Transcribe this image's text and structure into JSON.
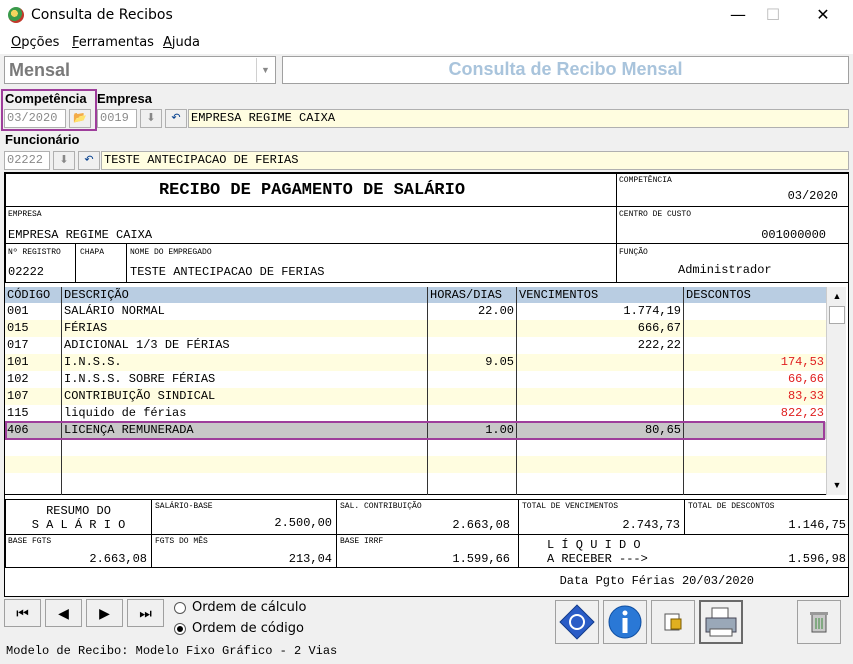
{
  "window": {
    "title": "Consulta de Recibos",
    "minimize": "—",
    "maximize": "☐",
    "close": "✕"
  },
  "menu": {
    "opcoes_ul": "O",
    "opcoes_rest": "pções",
    "ferramentas_ul": "F",
    "ferramentas_rest": "erramentas",
    "ajuda_ul": "A",
    "ajuda_rest": "juda"
  },
  "period_select": {
    "value": "Mensal"
  },
  "banner": "Consulta de Recibo Mensal",
  "filters": {
    "competencia_label": "Competência",
    "empresa_label": "Empresa",
    "funcionario_label": "Funcionário",
    "competencia_value": "03/2020",
    "empresa_code": "0019",
    "empresa_name": "EMPRESA REGIME CAIXA",
    "funcionario_code": "02222",
    "funcionario_name": "TESTE ANTECIPACAO DE FERIAS"
  },
  "receipt": {
    "title": "RECIBO DE PAGAMENTO DE SALÁRIO",
    "competencia_label": "COMPETÊNCIA",
    "competencia": "03/2020",
    "empresa_label": "EMPRESA",
    "empresa": "EMPRESA REGIME CAIXA",
    "centro_custo_label": "CENTRO DE CUSTO",
    "centro_custo": "001000000",
    "registro_label": "Nº REGISTRO",
    "registro": "02222",
    "chapa_label": "CHAPA",
    "nome_label": "NOME DO EMPREGADO",
    "nome": "TESTE ANTECIPACAO DE FERIAS",
    "funcao_label": "FUNÇÃO",
    "funcao": "Administrador",
    "columns": {
      "codigo": "CÓDIGO",
      "descricao": "DESCRIÇÃO",
      "horas": "HORAS/DIAS",
      "vencimentos": "VENCIMENTOS",
      "descontos": "DESCONTOS"
    },
    "rows": [
      {
        "codigo": "001",
        "descricao": "SALÁRIO NORMAL",
        "horas": "22.00",
        "vencimentos": "1.774,19",
        "descontos": ""
      },
      {
        "codigo": "015",
        "descricao": "FÉRIAS",
        "horas": "",
        "vencimentos": "666,67",
        "descontos": ""
      },
      {
        "codigo": "017",
        "descricao": "ADICIONAL 1/3 DE FÉRIAS",
        "horas": "",
        "vencimentos": "222,22",
        "descontos": ""
      },
      {
        "codigo": "101",
        "descricao": "I.N.S.S.",
        "horas": "9.05",
        "vencimentos": "",
        "descontos": "174,53"
      },
      {
        "codigo": "102",
        "descricao": "I.N.S.S. SOBRE FÉRIAS",
        "horas": "",
        "vencimentos": "",
        "descontos": "66,66"
      },
      {
        "codigo": "107",
        "descricao": "CONTRIBUIÇÃO SINDICAL",
        "horas": "",
        "vencimentos": "",
        "descontos": "83,33"
      },
      {
        "codigo": "115",
        "descricao": "liquido de férias",
        "horas": "",
        "vencimentos": "",
        "descontos": "822,23"
      },
      {
        "codigo": "406",
        "descricao": "LICENÇA REMUNERADA",
        "horas": "1.00",
        "vencimentos": "80,65",
        "descontos": ""
      }
    ],
    "resumo_line1": "RESUMO DO",
    "resumo_line2": "S A L Á R I O",
    "salario_base_label": "SALÁRIO-BASE",
    "salario_base": "2.500,00",
    "sal_contrib_label": "SAL. CONTRIBUIÇÃO",
    "sal_contrib": "2.663,08",
    "total_venc_label": "TOTAL DE VENCIMENTOS",
    "total_venc": "2.743,73",
    "total_desc_label": "TOTAL DE DESCONTOS",
    "total_desc": "1.146,75",
    "base_fgts_label": "BASE FGTS",
    "base_fgts": "2.663,08",
    "fgts_mes_label": "FGTS DO MÊS",
    "fgts_mes": "213,04",
    "base_irrf_label": "BASE IRRF",
    "base_irrf": "1.599,66",
    "liquido_line1": "L Í Q U I D O",
    "liquido_line2": "A RECEBER --->",
    "liquido": "1.596,98",
    "data_pgto": "Data Pgto Férias 20/03/2020"
  },
  "nav": {
    "first": "⏮",
    "prev": "◀",
    "next": "▶",
    "last": "⏭"
  },
  "order": {
    "calculo": "Ordem de cálculo",
    "codigo": "Ordem de código",
    "selected": "codigo"
  },
  "status": "Modelo de Recibo: Modelo Fixo Gráfico - 2 Vias",
  "colors": {
    "discount": "#e02020",
    "header_bg": "#b9cde2",
    "row_alt": "#fffde0",
    "selected_row": "#c8c8c8",
    "highlight": "#9e3e9b"
  }
}
